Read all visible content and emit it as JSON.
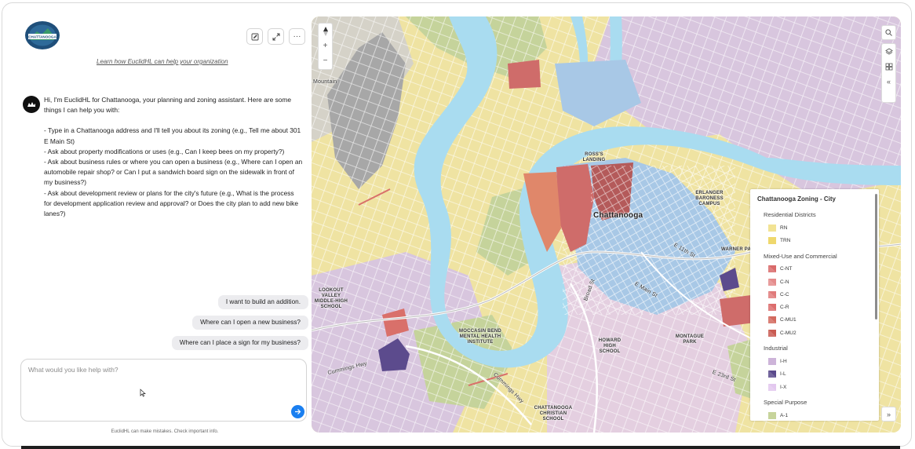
{
  "chat": {
    "learn_link": "Learn how EuclidHL can help your organization",
    "intro": "Hi, I'm EuclidHL for Chattanooga, your planning and zoning assistant. Here are some things I can help you with:",
    "bullets": [
      "- Type in a Chattanooga address and I'll tell you about its zoning (e.g., Tell me about 301 E Main St)",
      "- Ask about property modifications or uses (e.g., Can I keep bees on my property?)",
      "- Ask about business rules or where you can open a business (e.g., Where can I open an automobile repair shop? or Can I put a sandwich board sign on the sidewalk in front of my business?)",
      "- Ask about development review or plans for the city's future (e.g., What is the process for development application review and approval? or Does the city plan to add new bike lanes?)"
    ],
    "suggestions": [
      "I want to build an addition.",
      "Where can I open a new business?",
      "Where can I place a sign for my business?"
    ],
    "input_placeholder": "What would you like help with?",
    "disclaimer": "EuclidHL can make mistakes. Check important info."
  },
  "logo": {
    "text": "CHATTANOOGA"
  },
  "map": {
    "labels": {
      "chattanooga": "Chattanooga",
      "mountain": "Mountain",
      "ross_landing": "ROSS'S LANDING",
      "erlanger": "ERLANGER BARONESS CAMPUS",
      "warner_park": "WARNER PARK",
      "lookout_valley": "LOOKOUT VALLEY MIDDLE-HIGH SCHOOL",
      "moccasin_bend": "MOCCASIN BEND MENTAL HEALTH INSTITUTE",
      "howard": "HOWARD HIGH SCHOOL",
      "montague": "MONTAGUE PARK",
      "christian": "CHATTANOOGA CHRISTIAN SCHOOL",
      "cummings_hwy": "Cummings Hwy",
      "cummings_hwy_2": "Cummings Hwy",
      "e_main": "E Main St",
      "e_23rd": "E 23rd St",
      "e_11th": "E 11th St",
      "broad": "Broad St"
    }
  },
  "legend": {
    "title": "Chattanooga Zoning - City",
    "groups": [
      {
        "name": "Residential Districts",
        "items": [
          {
            "label": "RN",
            "color": "#f2e394",
            "shape": "square"
          },
          {
            "label": "TRN",
            "color": "#efd86d",
            "shape": "square"
          }
        ]
      },
      {
        "name": "Mixed-Use and Commercial",
        "items": [
          {
            "label": "C-NT",
            "color": "#d96a6a",
            "shape": "tri"
          },
          {
            "label": "C-N",
            "color": "#e48b8b",
            "shape": "tri"
          },
          {
            "label": "C-C",
            "color": "#e07b7b",
            "shape": "tri"
          },
          {
            "label": "C-R",
            "color": "#dc6d6d",
            "shape": "tri"
          },
          {
            "label": "C-MU1",
            "color": "#d36a5f",
            "shape": "tri"
          },
          {
            "label": "C-MU2",
            "color": "#c95b52",
            "shape": "tri"
          }
        ]
      },
      {
        "name": "Industrial",
        "items": [
          {
            "label": "I-H",
            "color": "#cdb4d9",
            "shape": "square"
          },
          {
            "label": "I-L",
            "color": "#5b4a8c",
            "shape": "tri"
          },
          {
            "label": "I-X",
            "color": "#e3c8ef",
            "shape": "tri"
          }
        ]
      },
      {
        "name": "Special Purpose",
        "items": [
          {
            "label": "A-1",
            "color": "#c7d49b",
            "shape": "square"
          }
        ]
      }
    ]
  },
  "colors": {
    "river": "#a9dcf0",
    "residential": "#f0e39c",
    "institutional": "#d6c3de",
    "park": "#c4d49a",
    "downtown": "#a8c8e6",
    "commercial": "#d9706a",
    "industrial_light": "#5c4b8d",
    "send": "#1a7ff0"
  }
}
